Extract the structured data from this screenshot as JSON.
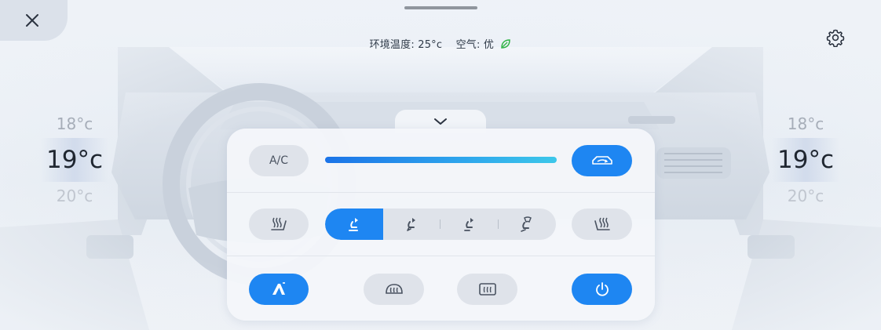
{
  "status": {
    "ambient_text": "环境温度: 25°c",
    "air_label": "空气:",
    "air_value": "优",
    "air_icon": "leaf-icon"
  },
  "icons": {
    "close": "close-icon",
    "settings": "gear-icon",
    "expand": "chevron-down-icon"
  },
  "temp_left": {
    "above": "18°c",
    "selected": "19°c",
    "below": "20°c"
  },
  "temp_right": {
    "above": "18°c",
    "selected": "19°c",
    "below": "20°c"
  },
  "controls": {
    "ac_label": "A/C",
    "fan_level": 1.0,
    "recirculation": {
      "active": true,
      "icon": "car-recirculation-icon"
    },
    "seat_heat_left": {
      "active": false,
      "icon": "seat-heat-left-icon"
    },
    "seat_heat_right": {
      "active": false,
      "icon": "seat-heat-right-icon"
    },
    "airflow_modes": [
      {
        "icon": "airflow-face-icon",
        "active": true
      },
      {
        "icon": "airflow-face-feet-icon",
        "active": false
      },
      {
        "icon": "airflow-feet-icon",
        "active": false
      },
      {
        "icon": "airflow-defrost-feet-icon",
        "active": false
      }
    ],
    "auto": {
      "label": "A",
      "active": true,
      "icon": "auto-icon"
    },
    "front_defrost": {
      "active": false,
      "icon": "front-defrost-icon"
    },
    "rear_defrost": {
      "active": false,
      "icon": "rear-defrost-icon"
    },
    "power": {
      "active": true,
      "icon": "power-icon"
    }
  },
  "colors": {
    "accent": "#1e86f2",
    "pill": "#dfe3ea",
    "leaf": "#2fb344"
  }
}
